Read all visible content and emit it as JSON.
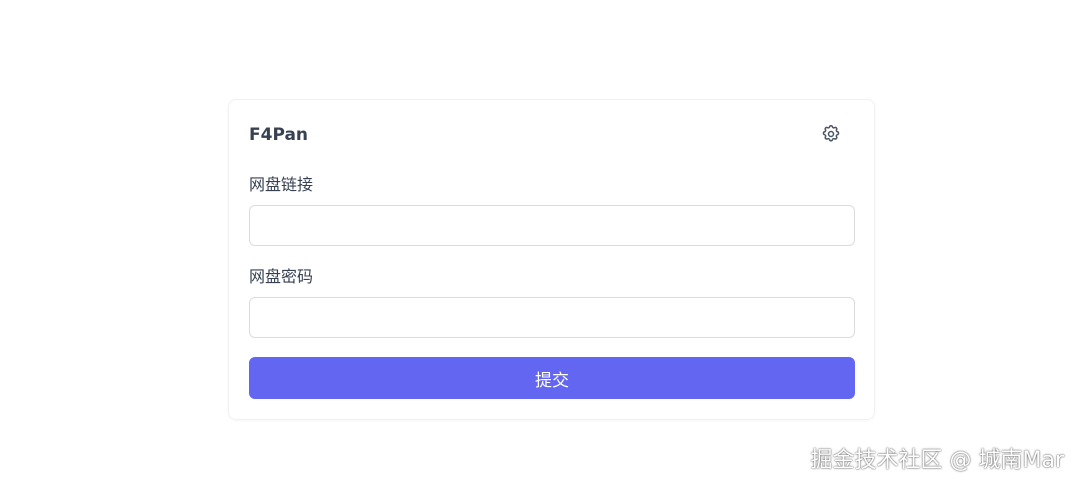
{
  "app": {
    "title": "F4Pan",
    "settings_icon": "gear-icon"
  },
  "form": {
    "link_label": "网盘链接",
    "link_value": "",
    "link_placeholder": "",
    "password_label": "网盘密码",
    "password_value": "",
    "password_placeholder": "",
    "submit_label": "提交"
  },
  "watermark": {
    "text": "掘金技术社区 @ 城南Mar"
  },
  "colors": {
    "accent": "#6366f1",
    "text": "#374151",
    "border": "#d9dce1"
  }
}
